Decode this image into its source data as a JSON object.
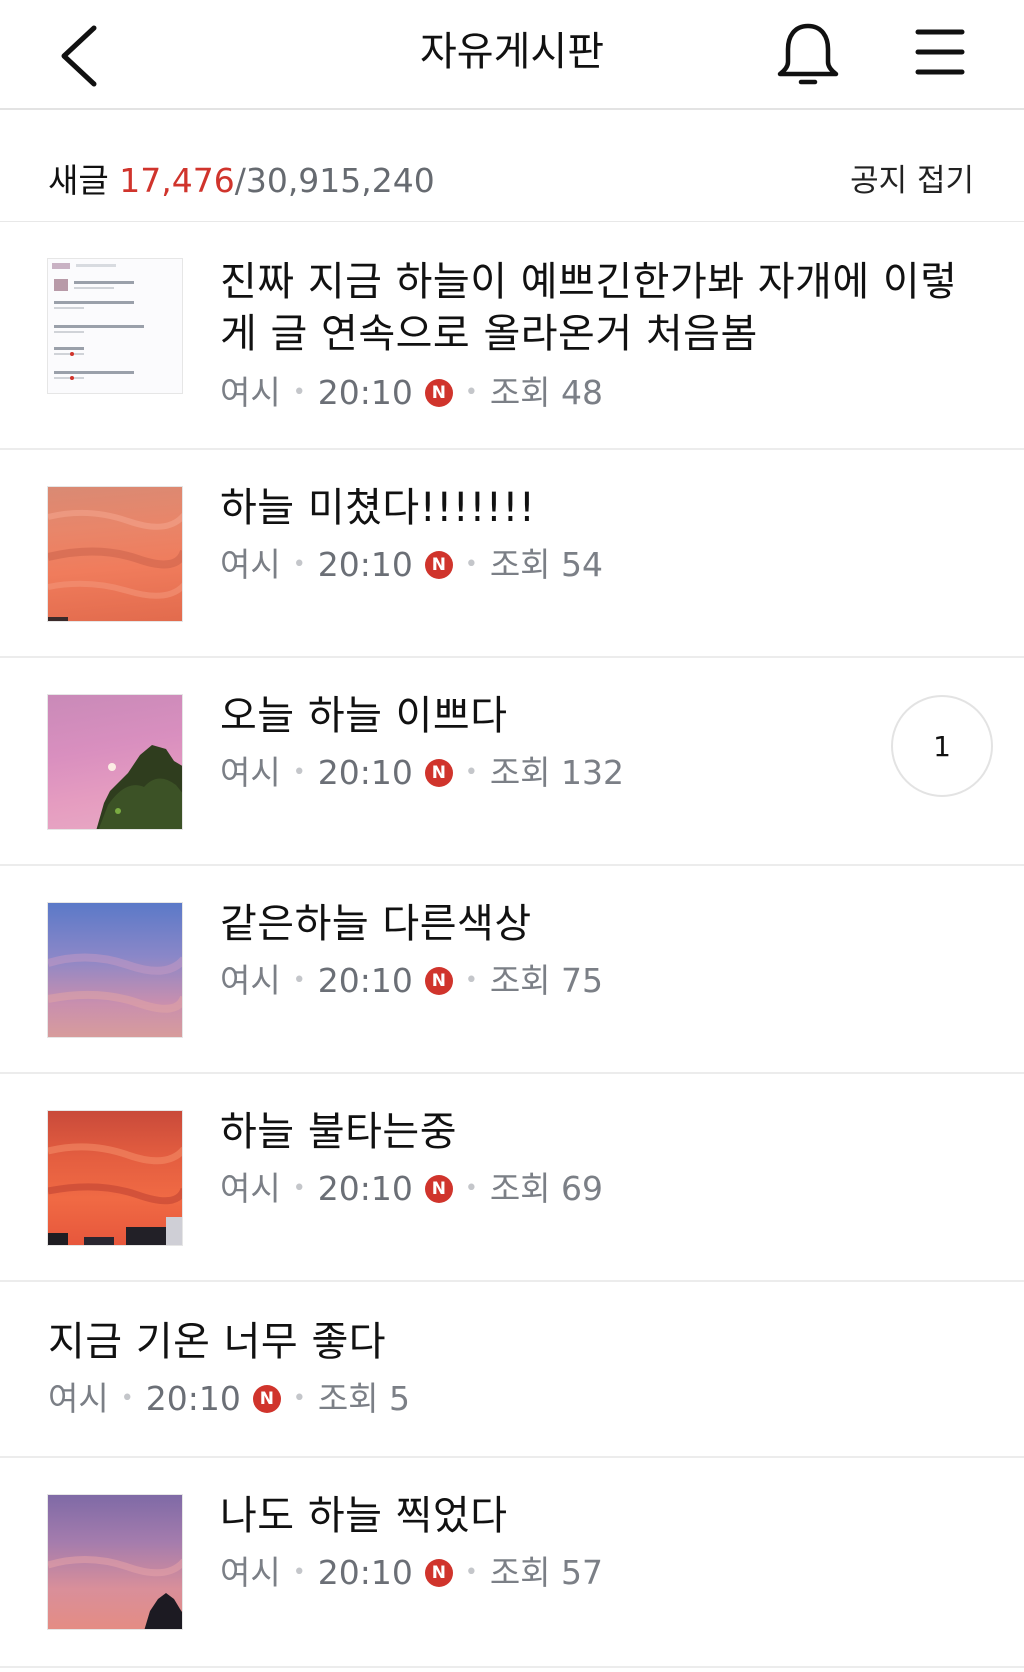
{
  "header": {
    "title": "자유게시판",
    "back_icon": "chevron-left-icon",
    "bell_icon": "bell-icon",
    "menu_icon": "hamburger-menu-icon"
  },
  "stats": {
    "label": "새글",
    "new_count": "17,476",
    "separator": "/",
    "total_count": "30,915,240",
    "fold_notice": "공지 접기"
  },
  "colors": {
    "accent_red": "#d0342c",
    "meta_gray": "#7b7f86",
    "divider": "#ececec"
  },
  "posts": [
    {
      "title": "진짜 지금 하늘이 예쁘긴한가봐 자개에 이렇게 글 연속으로 올라온거 처음봄",
      "author": "여시",
      "time": "20:10",
      "new_badge": "N",
      "views": "조회 48",
      "thumbnail": "screenshot-list"
    },
    {
      "title": "하늘 미쳤다!!!!!!!",
      "author": "여시",
      "time": "20:10",
      "new_badge": "N",
      "views": "조회 54",
      "thumbnail": "orange-sky"
    },
    {
      "title": "오늘 하늘 이쁘다",
      "author": "여시",
      "time": "20:10",
      "new_badge": "N",
      "views": "조회 132",
      "thumbnail": "pink-sky-tree",
      "comments": "1"
    },
    {
      "title": "같은하늘 다른색상",
      "author": "여시",
      "time": "20:10",
      "new_badge": "N",
      "views": "조회 75",
      "thumbnail": "blue-pink-sky"
    },
    {
      "title": "하늘 불타는중",
      "author": "여시",
      "time": "20:10",
      "new_badge": "N",
      "views": "조회 69",
      "thumbnail": "red-sky-buildings"
    },
    {
      "title": "지금 기온 너무 좋다",
      "author": "여시",
      "time": "20:10",
      "new_badge": "N",
      "views": "조회 5"
    },
    {
      "title": "나도 하늘 찍었다",
      "author": "여시",
      "time": "20:10",
      "new_badge": "N",
      "views": "조회 57",
      "thumbnail": "purple-sky-tree"
    }
  ]
}
